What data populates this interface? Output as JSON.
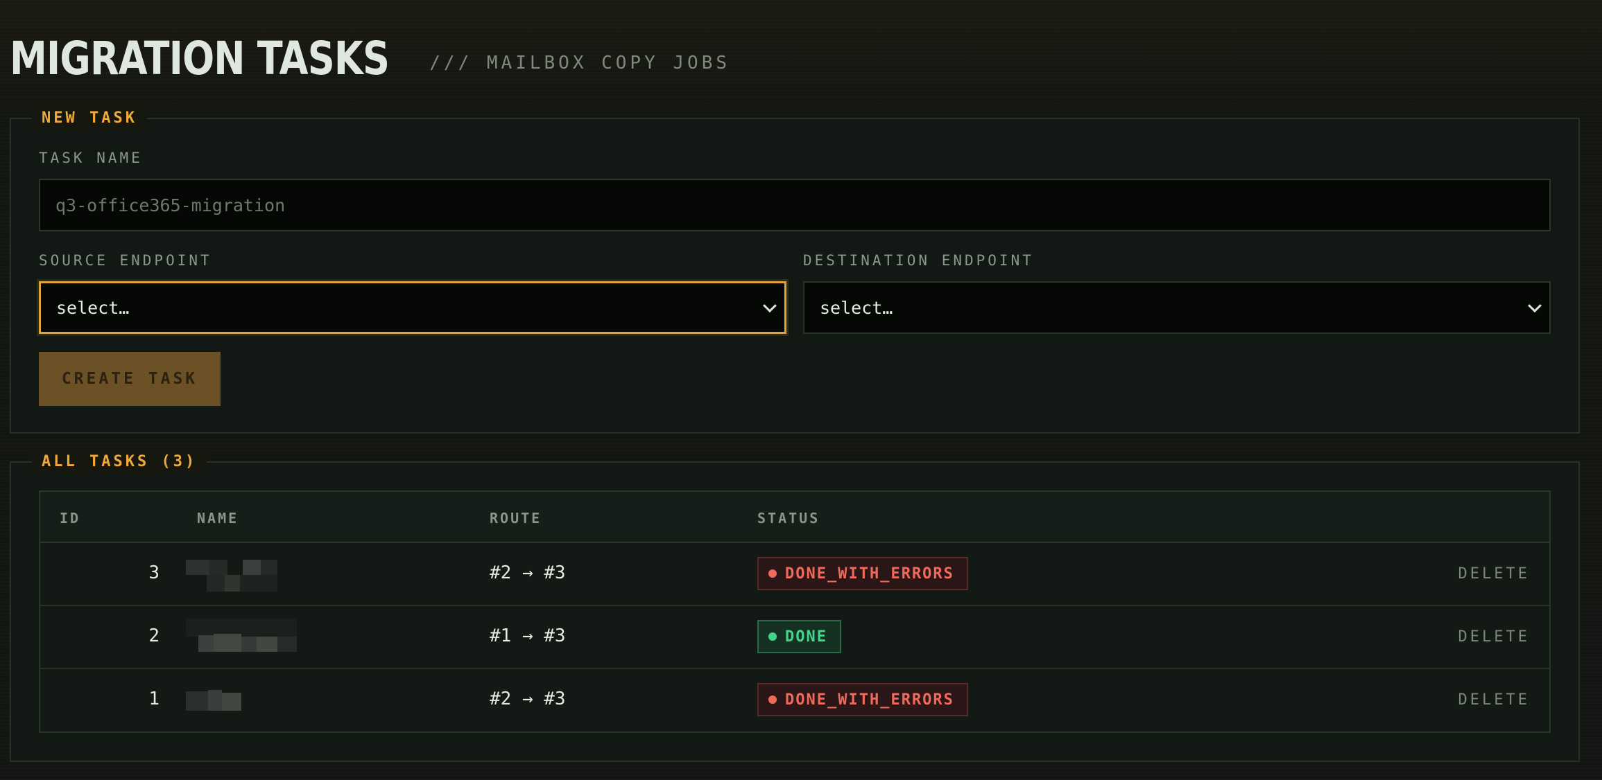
{
  "header": {
    "title": "MIGRATION TASKS",
    "subtitle": "/// MAILBOX COPY JOBS"
  },
  "new_task": {
    "legend": "NEW TASK",
    "task_name_label": "TASK NAME",
    "task_name_placeholder": "q3-office365-migration",
    "source_label": "SOURCE ENDPOINT",
    "source_value": "select…",
    "destination_label": "DESTINATION ENDPOINT",
    "destination_value": "select…",
    "create_button": "CREATE TASK"
  },
  "all_tasks": {
    "legend": "ALL TASKS (3)",
    "columns": [
      "ID",
      "NAME",
      "ROUTE",
      "STATUS"
    ],
    "rows": [
      {
        "id": "3",
        "route": "#2 → #3",
        "status": "DONE_WITH_ERRORS",
        "action": "DELETE"
      },
      {
        "id": "2",
        "route": "#1 → #3",
        "status": "DONE",
        "action": "DELETE"
      },
      {
        "id": "1",
        "route": "#2 → #3",
        "status": "DONE_WITH_ERRORS",
        "action": "DELETE"
      }
    ]
  },
  "colors": {
    "accent": "#f2a93b",
    "error": "#f06a5c",
    "success": "#43d68a",
    "background": "#121511"
  }
}
